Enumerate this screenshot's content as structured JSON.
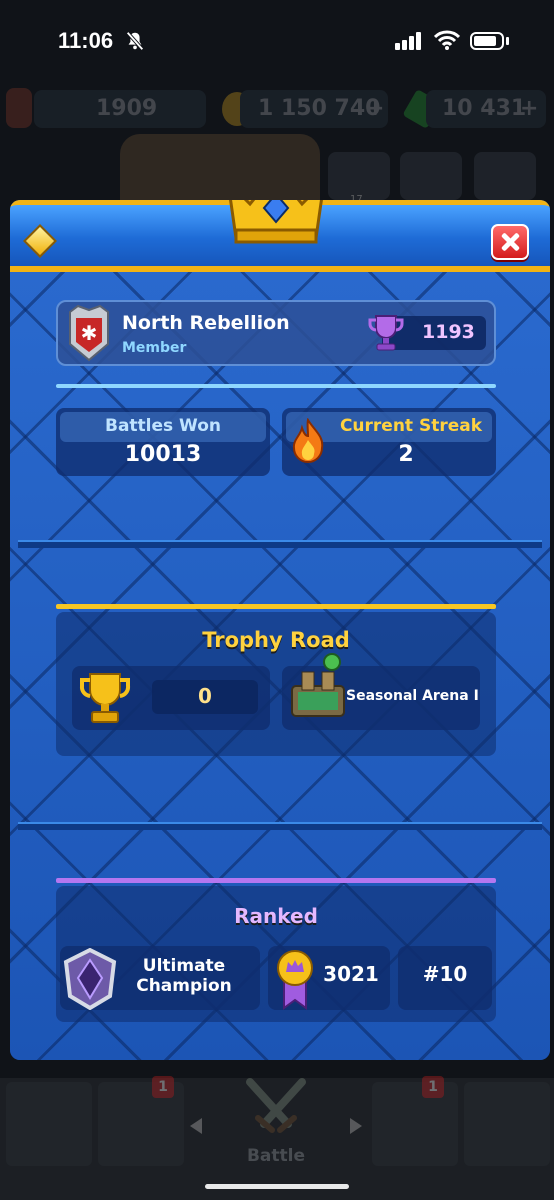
{
  "status_bar": {
    "time": "11:06"
  },
  "background": {
    "level_value": "1909",
    "gold_value": "1 150 740",
    "gold_plus": "+",
    "gems_value": "10 431",
    "gems_plus": "+",
    "friends_count": "17"
  },
  "clan": {
    "name": "North Rebellion",
    "role": "Member",
    "trophies": "1193"
  },
  "stats": {
    "battles_won_label": "Battles Won",
    "battles_won_value": "10013",
    "current_streak_label": "Current Streak",
    "current_streak_value": "2"
  },
  "trophy_road": {
    "title": "Trophy Road",
    "trophies": "0",
    "arena": "Seasonal Arena I"
  },
  "ranked": {
    "title": "Ranked",
    "league_line1": "Ultimate",
    "league_line2": "Champion",
    "rating": "3021",
    "rank": "#10"
  },
  "bottom_nav": {
    "battle_label": "Battle",
    "cards_badge": "1",
    "clan_badge": "1"
  },
  "colors": {
    "modal_blue": "#1a4fa8",
    "header_gold": "#f2b315",
    "trophy_road_accent": "#f6c624",
    "ranked_accent": "#b477f0",
    "close_red": "#d41c1c"
  }
}
